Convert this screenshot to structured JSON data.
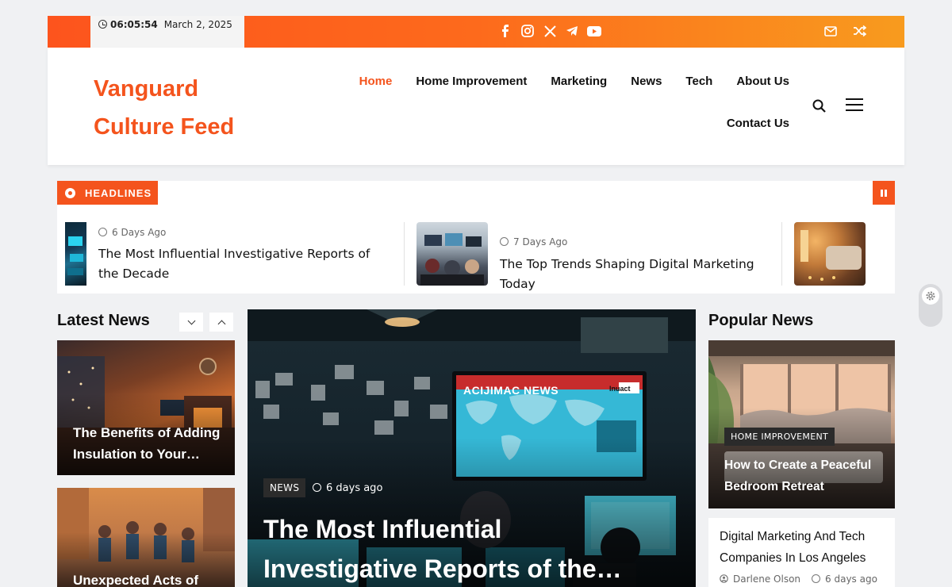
{
  "topbar": {
    "time": "06:05:54",
    "date": "March 2, 2025",
    "social_icons": [
      "facebook-icon",
      "instagram-icon",
      "x-icon",
      "telegram-icon",
      "youtube-icon"
    ],
    "right_icons": [
      "mail-icon",
      "shuffle-icon"
    ]
  },
  "header": {
    "logo_line1": "Vanguard",
    "logo_line2": "Culture Feed",
    "nav_row1": [
      "Home",
      "Home Improvement",
      "Marketing",
      "News",
      "Tech",
      "About Us"
    ],
    "nav_row2": [
      "Contact Us"
    ],
    "active_nav": "Home",
    "brand_color": "#f4541d"
  },
  "ticker": {
    "label": "HEADLINES",
    "items": [
      {
        "meta": "6 Days Ago",
        "title": "The Most Influential Investigative Reports of the Decade"
      },
      {
        "meta": "7 Days Ago",
        "title": "The Top Trends Shaping Digital Marketing Today"
      },
      {
        "meta": "",
        "title": ""
      }
    ]
  },
  "latest": {
    "title": "Latest News",
    "cards": [
      {
        "title": "The Benefits of Adding Insulation to Your…"
      },
      {
        "title": "Unexpected Acts of"
      }
    ]
  },
  "featured": {
    "category": "NEWS",
    "meta": "6 days ago",
    "title_line1": "The Most Influential",
    "title_line2": "Investigative Reports of the…",
    "screen_text": "ACIJIMAC NEWS",
    "screen_corner": "Inuact"
  },
  "popular": {
    "title": "Popular News",
    "card": {
      "category": "HOME IMPROVEMENT",
      "title": "How to Create a Peaceful Bedroom Retreat"
    },
    "list_item": {
      "title": "Digital Marketing And Tech Companies In Los Angeles",
      "author": "Darlene Olson",
      "meta": "6 days ago"
    }
  }
}
